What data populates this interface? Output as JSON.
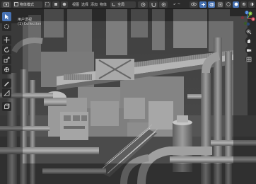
{
  "header": {
    "mode": "物体模式",
    "menus": [
      "视图",
      "选择",
      "添加",
      "物体"
    ],
    "transform_orientation": "全局",
    "gizmo_label": "↙ ~",
    "shading_icons": [
      "wireframe-icon",
      "solid-icon",
      "material-icon",
      "rendered-icon"
    ]
  },
  "viewport": {
    "view_name": "用户透视",
    "collection": "(1) Collection"
  },
  "toolbar": {
    "tools": [
      "cursor-icon",
      "move-icon",
      "rotate-icon",
      "scale-icon",
      "transform-icon",
      "annotate-icon",
      "measure-icon",
      "add-cube-icon"
    ]
  },
  "navigation": {
    "axes": [
      "X",
      "Y",
      "Z"
    ]
  },
  "colors": {
    "header_bg": "#2b2b2b",
    "accent": "#4772b3",
    "x_axis": "#e0495a",
    "y_axis": "#7db83a",
    "z_axis": "#3c7ad9"
  }
}
